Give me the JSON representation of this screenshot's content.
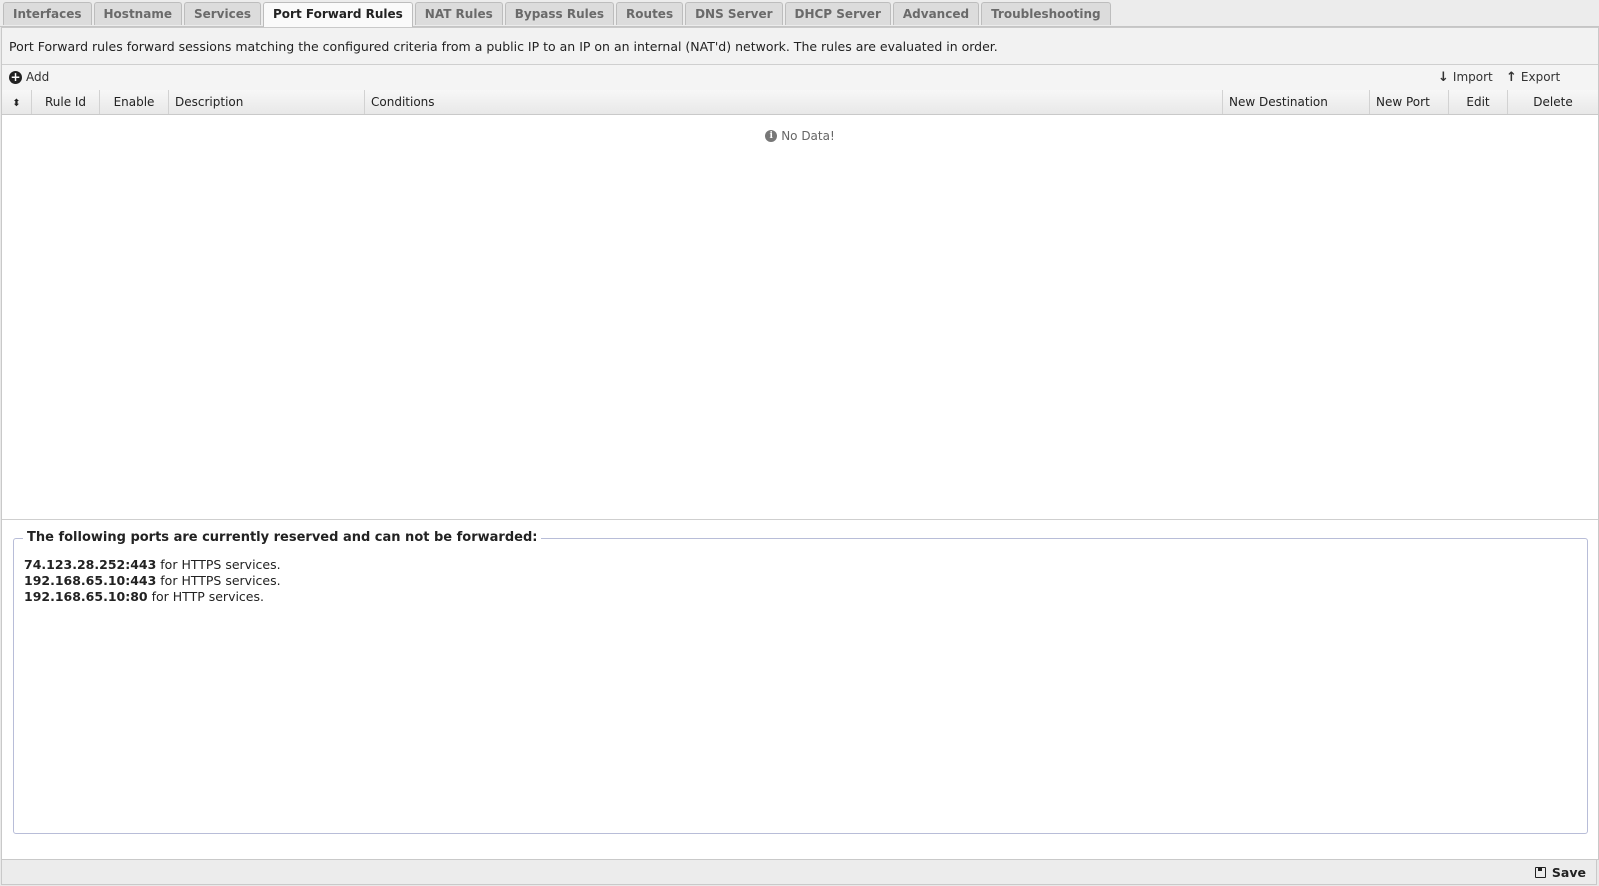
{
  "tabs": [
    {
      "label": "Interfaces",
      "active": false
    },
    {
      "label": "Hostname",
      "active": false
    },
    {
      "label": "Services",
      "active": false
    },
    {
      "label": "Port Forward Rules",
      "active": true
    },
    {
      "label": "NAT Rules",
      "active": false
    },
    {
      "label": "Bypass Rules",
      "active": false
    },
    {
      "label": "Routes",
      "active": false
    },
    {
      "label": "DNS Server",
      "active": false
    },
    {
      "label": "DHCP Server",
      "active": false
    },
    {
      "label": "Advanced",
      "active": false
    },
    {
      "label": "Troubleshooting",
      "active": false
    }
  ],
  "description": "Port Forward rules forward sessions matching the configured criteria from a public IP to an IP on an internal (NAT'd) network. The rules are evaluated in order.",
  "toolbar": {
    "add_label": "Add",
    "import_label": "Import",
    "export_label": "Export"
  },
  "grid": {
    "columns": [
      "",
      "Rule Id",
      "Enable",
      "Description",
      "Conditions",
      "New Destination",
      "New Port",
      "Edit",
      "Delete"
    ],
    "rows": [],
    "empty_text": "No Data!"
  },
  "reserved": {
    "legend": "The following ports are currently reserved and can not be forwarded:",
    "items": [
      {
        "address": "74.123.28.252:443",
        "text": " for HTTPS services."
      },
      {
        "address": "192.168.65.10:443",
        "text": " for HTTPS services."
      },
      {
        "address": "192.168.65.10:80",
        "text": " for HTTP services."
      }
    ]
  },
  "footer": {
    "save_label": "Save"
  }
}
